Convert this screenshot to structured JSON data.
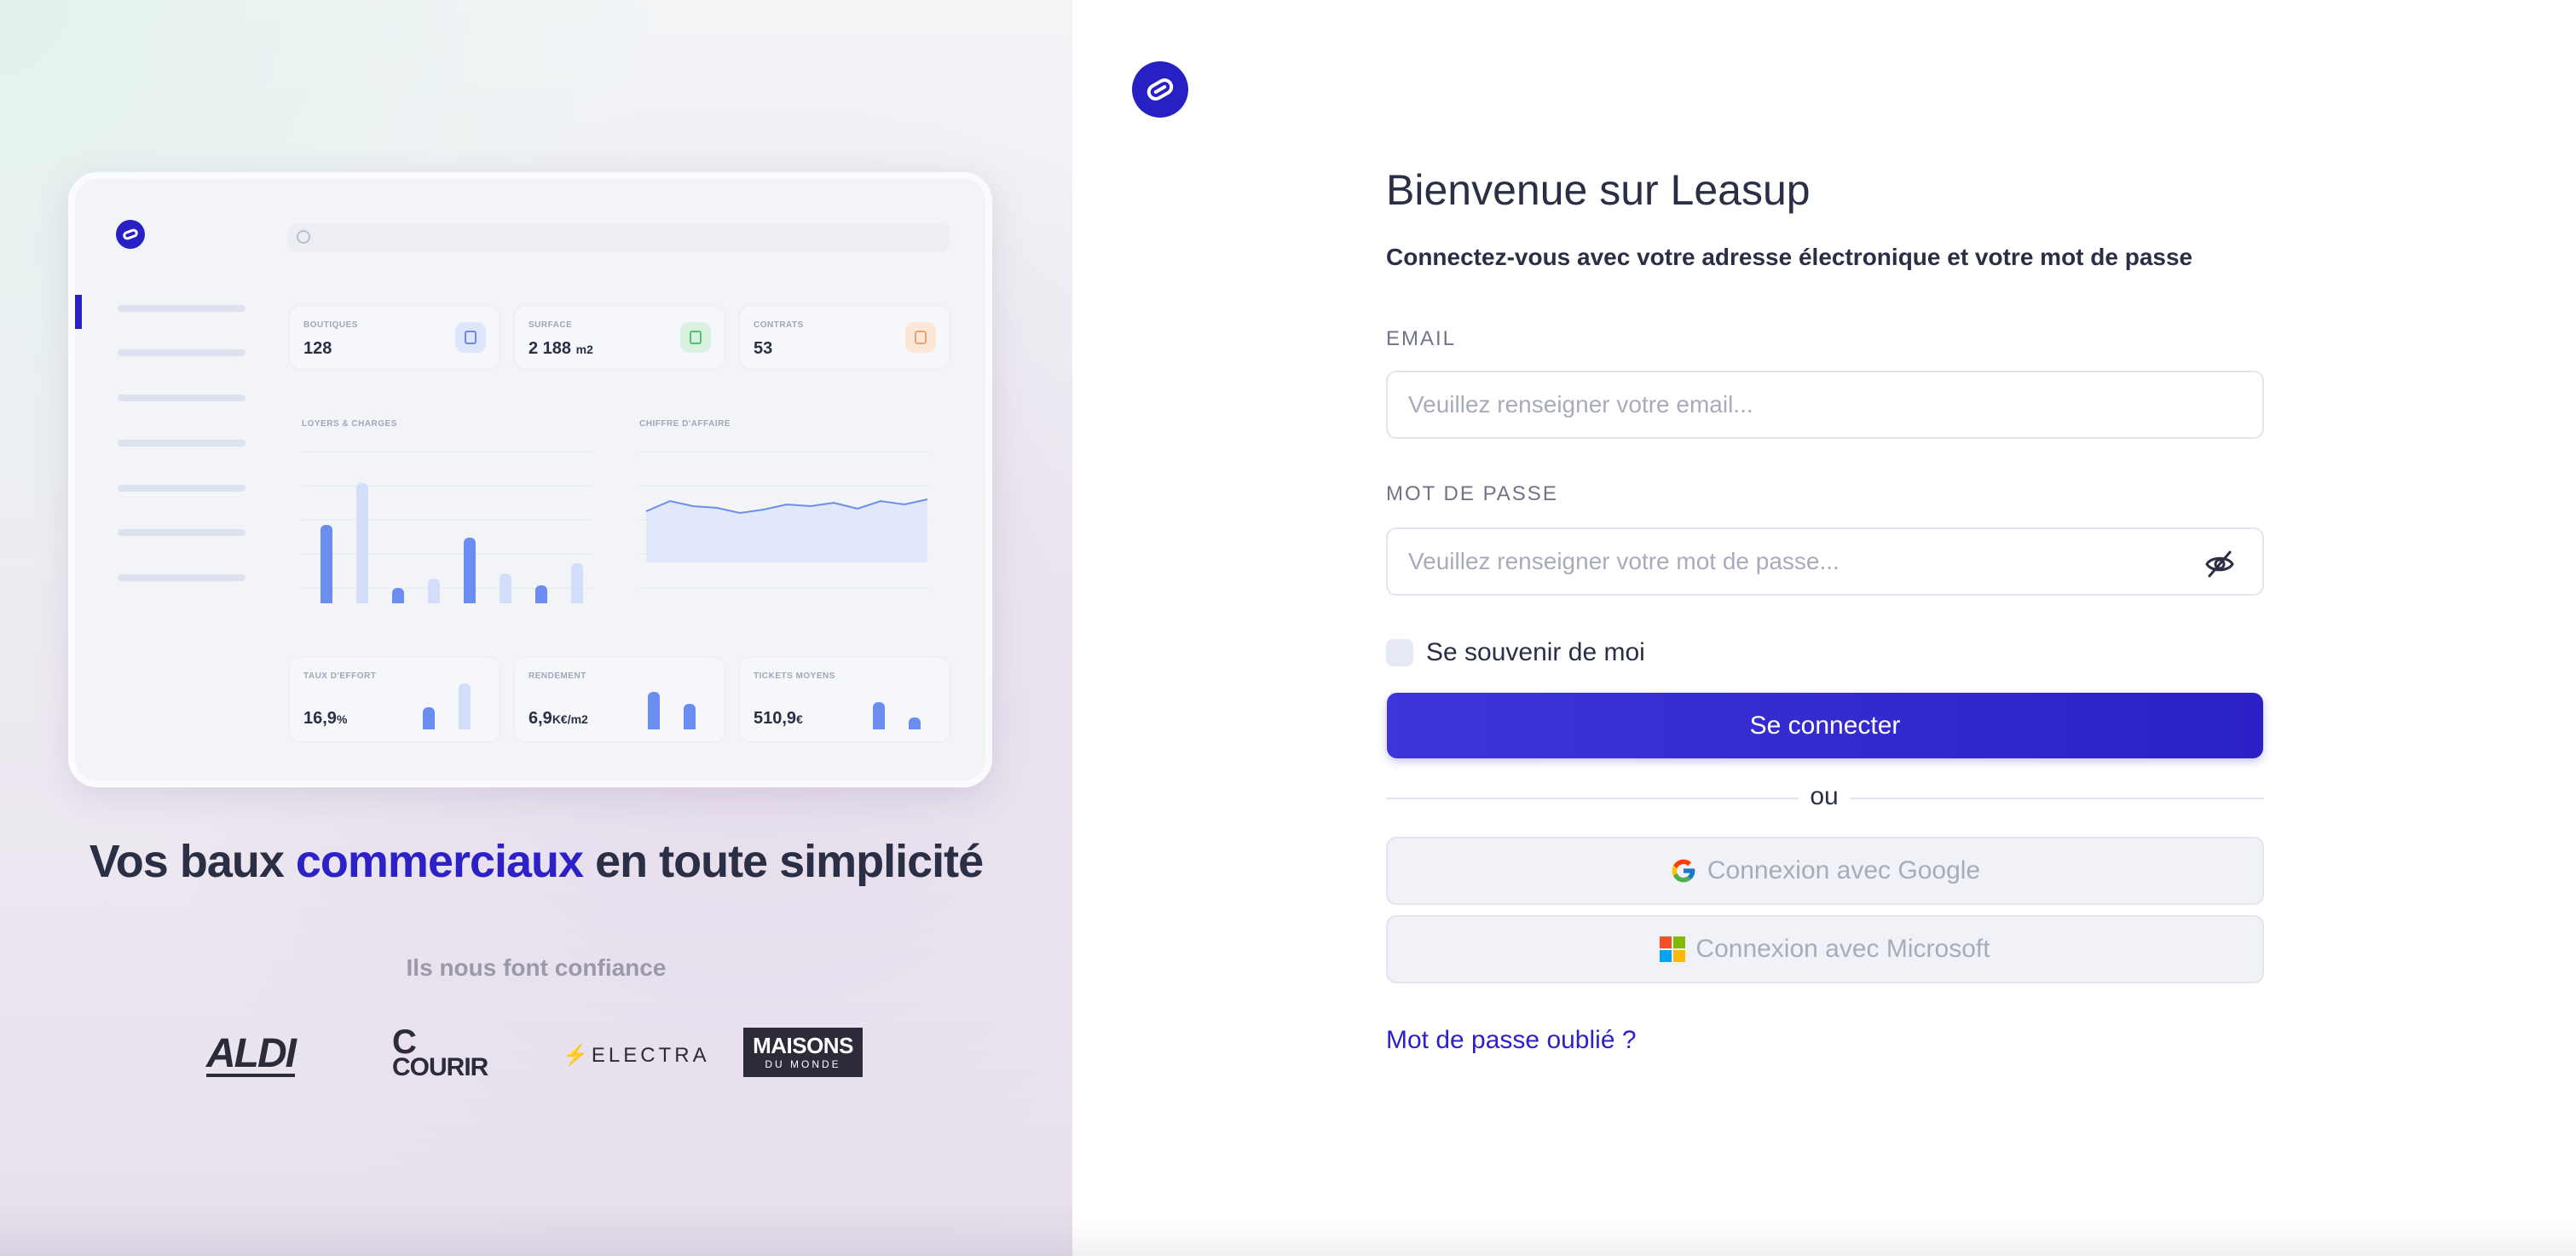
{
  "app": {
    "name": "Leasup",
    "brand_color": "#2721c3"
  },
  "hero": {
    "headline_before": "Vos baux",
    "headline_accent": "commerciaux",
    "headline_after": "en toute simplicité",
    "trust_label": "Ils nous font confiance",
    "brands": {
      "aldi": "ALDI",
      "courir": "COURIR",
      "electra": "ELECTRA",
      "maisons_line1": "MAISONS",
      "maisons_line2": "DU MONDE"
    }
  },
  "dashboard_preview": {
    "stats": [
      {
        "label": "BOUTIQUES",
        "value": "128",
        "unit": "",
        "icon": "bag-icon",
        "color": "#dfe6fb"
      },
      {
        "label": "SURFACE",
        "value": "2 188",
        "unit": "m2",
        "icon": "cube-icon",
        "color": "#d9f1df"
      },
      {
        "label": "CONTRATS",
        "value": "53",
        "unit": "",
        "icon": "book-icon",
        "color": "#fbe6d8"
      }
    ],
    "charts": {
      "rent_title": "LOYERS & CHARGES",
      "revenue_title": "CHIFFRE D'AFFAIRE",
      "rent_bars": [
        0.61,
        0.94,
        0.12,
        0.19,
        0.51,
        0.23,
        0.14,
        0.31
      ],
      "revenue_line": [
        0.5,
        0.2,
        0.35,
        0.4,
        0.55,
        0.45,
        0.3,
        0.35,
        0.25,
        0.42,
        0.2,
        0.3,
        0.15
      ]
    },
    "kpis": [
      {
        "label": "TAUX D'EFFORT",
        "value": "16,9",
        "unit": "%"
      },
      {
        "label": "RENDEMENT",
        "value": "6,9",
        "unit": "K€/m2"
      },
      {
        "label": "TICKETS MOYENS",
        "value": "510,9",
        "unit": "€"
      }
    ]
  },
  "login": {
    "title": "Bienvenue sur Leasup",
    "subtitle": "Connectez-vous avec votre adresse électronique et votre mot de passe",
    "email_label": "EMAIL",
    "email_placeholder": "Veuillez renseigner votre email...",
    "email_value": "",
    "password_label": "MOT DE PASSE",
    "password_placeholder": "Veuillez renseigner votre mot de passe...",
    "password_value": "",
    "remember_label": "Se souvenir de moi",
    "submit_label": "Se connecter",
    "or_label": "ou",
    "google_label": "Connexion avec Google",
    "microsoft_label": "Connexion avec Microsoft",
    "forgot_label": "Mot de passe oublié ?"
  }
}
